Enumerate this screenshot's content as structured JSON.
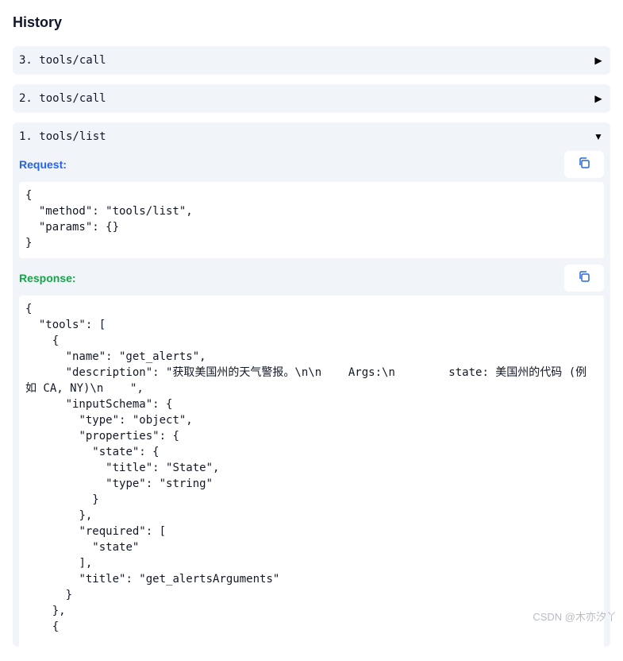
{
  "page": {
    "title": "History"
  },
  "history": {
    "items": [
      {
        "label": "3. tools/call",
        "toggle": "▶"
      },
      {
        "label": "2. tools/call",
        "toggle": "▶"
      },
      {
        "label": "1. tools/list",
        "toggle": "▼"
      }
    ],
    "expanded": {
      "request_label": "Request:",
      "request_color": "#2563eb",
      "request_json": "{\n  \"method\": \"tools/list\",\n  \"params\": {}\n}",
      "response_label": "Response:",
      "response_color": "#16a34a",
      "response_json": "{\n  \"tools\": [\n    {\n      \"name\": \"get_alerts\",\n      \"description\": \"获取美国州的天气警报。\\n\\n    Args:\\n        state: 美国州的代码 (例如 CA, NY)\\n    \",\n      \"inputSchema\": {\n        \"type\": \"object\",\n        \"properties\": {\n          \"state\": {\n            \"title\": \"State\",\n            \"type\": \"string\"\n          }\n        },\n        \"required\": [\n          \"state\"\n        ],\n        \"title\": \"get_alertsArguments\"\n      }\n    },\n    {"
    }
  },
  "watermark": "CSDN @木亦汐丫",
  "icons": {
    "copy": "copy-icon"
  }
}
